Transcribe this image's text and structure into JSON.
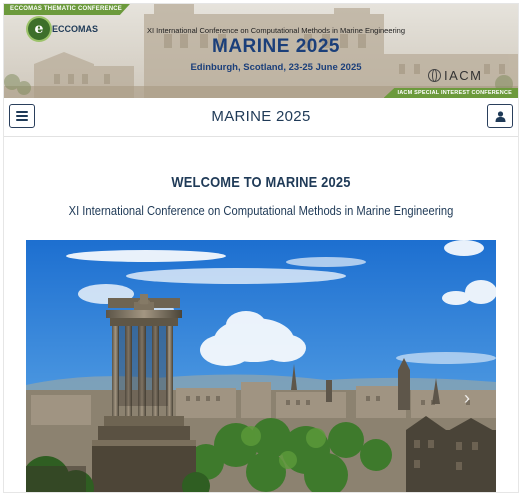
{
  "banner": {
    "tag_left": "ECCOMAS THEMATIC CONFERENCE",
    "tag_right": "IACM SPECIAL INTEREST CONFERENCE",
    "eccomas_logo": "ECCOMAS",
    "conference_full_name": "XI International Conference on Computational Methods in Marine Engineering",
    "conference_short_name": "MARINE 2025",
    "location_dates": "Edinburgh, Scotland, 23-25 June 2025",
    "iacm_logo": "IACM"
  },
  "navbar": {
    "title": "MARINE 2025",
    "menu_icon": "hamburger-menu-icon",
    "user_icon": "user-icon"
  },
  "main": {
    "heading": "WELCOME TO MARINE 2025",
    "subheading": "XI International Conference on Computational Methods in Marine Engineering"
  },
  "carousel": {
    "next_icon": "chevron-right-icon",
    "next_glyph": "›"
  },
  "colors": {
    "accent_green": "#6c9a3c",
    "navy": "#1f3a57",
    "title_blue": "#1b3f7a"
  }
}
